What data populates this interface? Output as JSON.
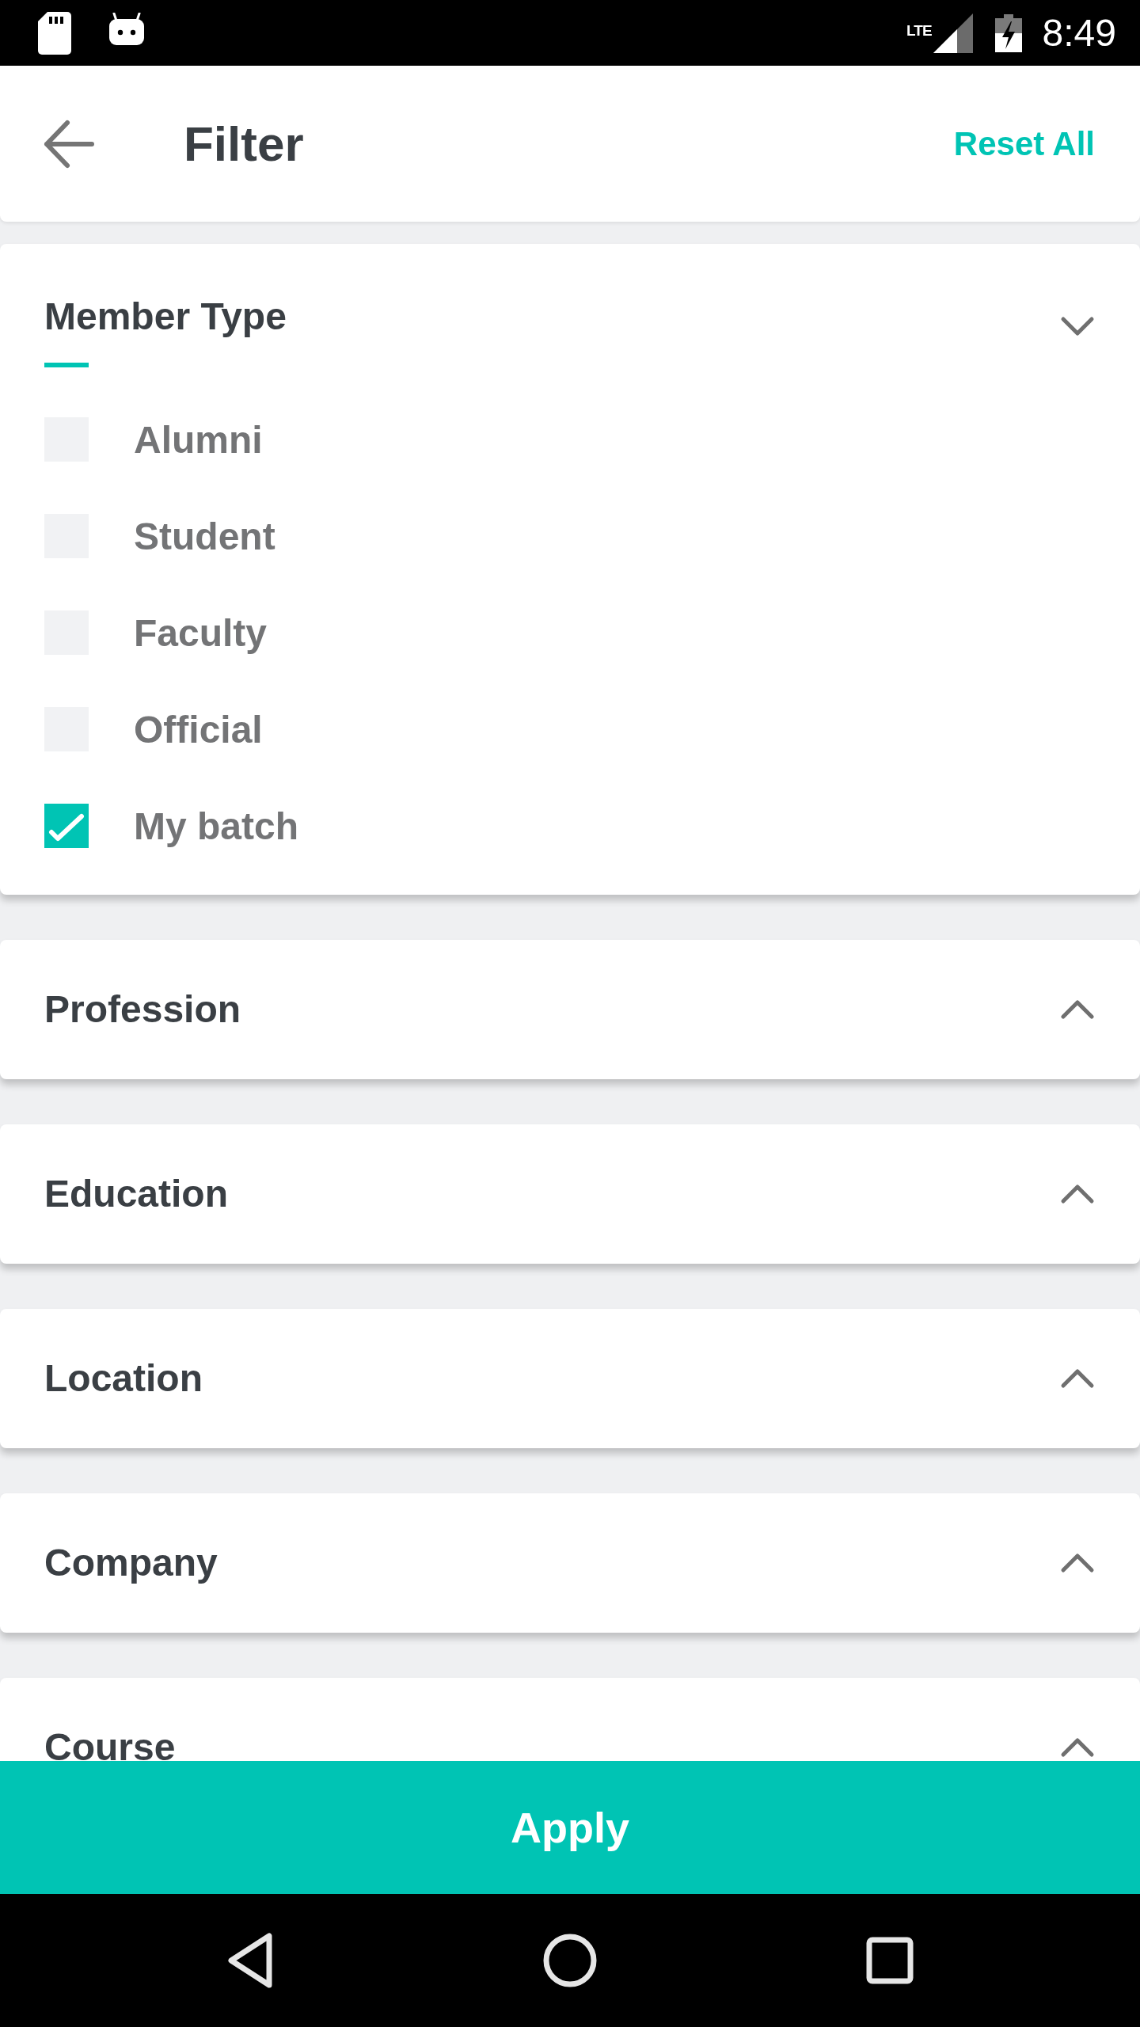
{
  "status_bar": {
    "network_type": "LTE",
    "time": "8:49"
  },
  "header": {
    "title": "Filter",
    "action": "Reset All"
  },
  "sections": [
    {
      "title": "Member Type",
      "expanded": true,
      "options": [
        {
          "label": "Alumni",
          "checked": false
        },
        {
          "label": "Student",
          "checked": false
        },
        {
          "label": "Faculty",
          "checked": false
        },
        {
          "label": "Official",
          "checked": false
        },
        {
          "label": "My batch",
          "checked": true
        }
      ]
    },
    {
      "title": "Profession",
      "expanded": false
    },
    {
      "title": "Education",
      "expanded": false
    },
    {
      "title": "Location",
      "expanded": false
    },
    {
      "title": "Company",
      "expanded": false
    },
    {
      "title": "Course",
      "expanded": false
    }
  ],
  "apply_button": "Apply"
}
